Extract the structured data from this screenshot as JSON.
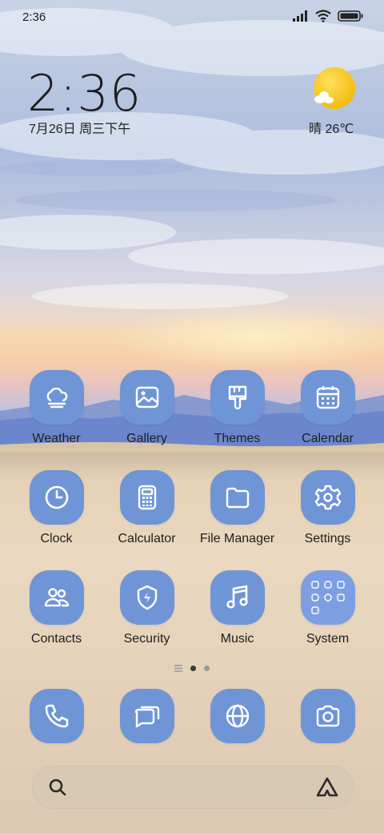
{
  "status_bar": {
    "time": "2:36"
  },
  "lock_widget": {
    "time": "2:36",
    "date": "7月26日 周三下午",
    "weather": "晴 26℃"
  },
  "apps": [
    {
      "label": "Weather",
      "icon": "weather-icon"
    },
    {
      "label": "Gallery",
      "icon": "gallery-icon"
    },
    {
      "label": "Themes",
      "icon": "themes-brush-icon"
    },
    {
      "label": "Calendar",
      "icon": "calendar-icon"
    },
    {
      "label": "Clock",
      "icon": "clock-icon"
    },
    {
      "label": "Calculator",
      "icon": "calculator-icon"
    },
    {
      "label": "File Manager",
      "icon": "folder-icon"
    },
    {
      "label": "Settings",
      "icon": "gear-icon"
    },
    {
      "label": "Contacts",
      "icon": "contacts-icon"
    },
    {
      "label": "Security",
      "icon": "shield-bolt-icon"
    },
    {
      "label": "Music",
      "icon": "music-note-icon"
    },
    {
      "label": "System",
      "icon": "folder-grid-icon"
    }
  ],
  "dock": [
    {
      "icon": "phone-icon"
    },
    {
      "icon": "messages-icon"
    },
    {
      "icon": "browser-globe-icon"
    },
    {
      "icon": "camera-icon"
    }
  ],
  "page_indicator": {
    "pages": 2,
    "current": 1
  },
  "colors": {
    "tile": "#6f95d6",
    "icon": "#ffffff",
    "text": "#1e1e1e"
  }
}
